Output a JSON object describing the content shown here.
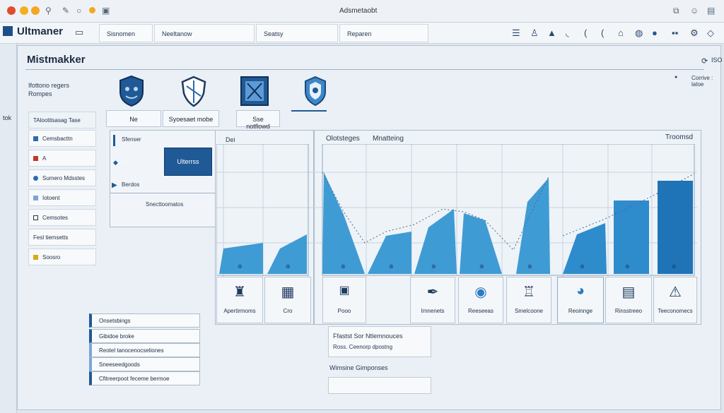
{
  "titlebar": {
    "window_title": "Adsmetaobt",
    "colors": {
      "close": "#e24b2e",
      "minimize": "#f2b01e",
      "maximize": "#f5a623"
    }
  },
  "menubar": {
    "app_name": "Ultmaner",
    "tabs": [
      "Sisnomen",
      "Neeltanow",
      "Seatsy",
      "Reparen"
    ],
    "icons": [
      "list-icon",
      "person-icon",
      "triangle-icon",
      "moon-icon",
      "bracket-icon",
      "gift-icon",
      "globe-icon",
      "user-circle-icon",
      "toggle-icon",
      "settings-icon",
      "droplet-icon"
    ]
  },
  "left_edge": {
    "label": "tok"
  },
  "page": {
    "title": "Mistmakker",
    "right_badge": "ISO",
    "right_meta": "Corrive : latoe"
  },
  "description": {
    "line1": "Ifottono regers",
    "line2": "Rompes"
  },
  "shields": [
    {
      "icon": "face-shield-icon"
    },
    {
      "icon": "outline-shield-icon"
    },
    {
      "icon": "square-shield-icon"
    },
    {
      "icon": "badge-shield-icon"
    }
  ],
  "category_tabs": [
    "Ne",
    "Syoesaet mobe",
    "Sse notflowd"
  ],
  "sidebar": {
    "items": [
      "TAlootitsasag Tase",
      "Cemsbacttn",
      "A",
      "Sumero Mdsstes",
      "Iotoent",
      "Cemsotes",
      "Fesl tiemsetts",
      "Soosro"
    ]
  },
  "panel_left": {
    "row1": "Sfenser",
    "button": "Ulterrss",
    "row2": "Berdos",
    "row3": "Snecttoomatos"
  },
  "chart_panel": {
    "small_title": "Dei",
    "main_tabs": [
      "Olotsteges",
      "Mnatteing"
    ],
    "right_label": "Troomsd"
  },
  "icon_row": [
    {
      "icon": "tower-icon",
      "label": "Apertirmoms"
    },
    {
      "icon": "calculator-icon",
      "label": "Cro"
    },
    {
      "icon": "ticket-icon",
      "label": "Pooo"
    },
    {
      "icon": "pen-tool-icon",
      "label": "Imnenets"
    },
    {
      "icon": "globe-icon",
      "label": "Reeseeas"
    },
    {
      "icon": "cup-icon",
      "label": "Smelcoone"
    },
    {
      "icon": "bulb-icon",
      "label": "Reoinnge"
    },
    {
      "icon": "wallet-icon",
      "label": "Rinsstreeo"
    },
    {
      "icon": "alert-icon",
      "label": "Teeconomecs"
    }
  ],
  "bottom_list": {
    "items": [
      "Onsetsbings",
      "Gibidoe broke",
      "Reotel tanocenocseliones",
      "Sneeseedgoods",
      "Cfitreerpoot feceme bermoe"
    ]
  },
  "info_box": {
    "title": "Ffastst Sor Ntlemnouces",
    "subtitle": "Ross. Ceenorp dpostng",
    "section": "Wimsine Gimponses"
  }
}
